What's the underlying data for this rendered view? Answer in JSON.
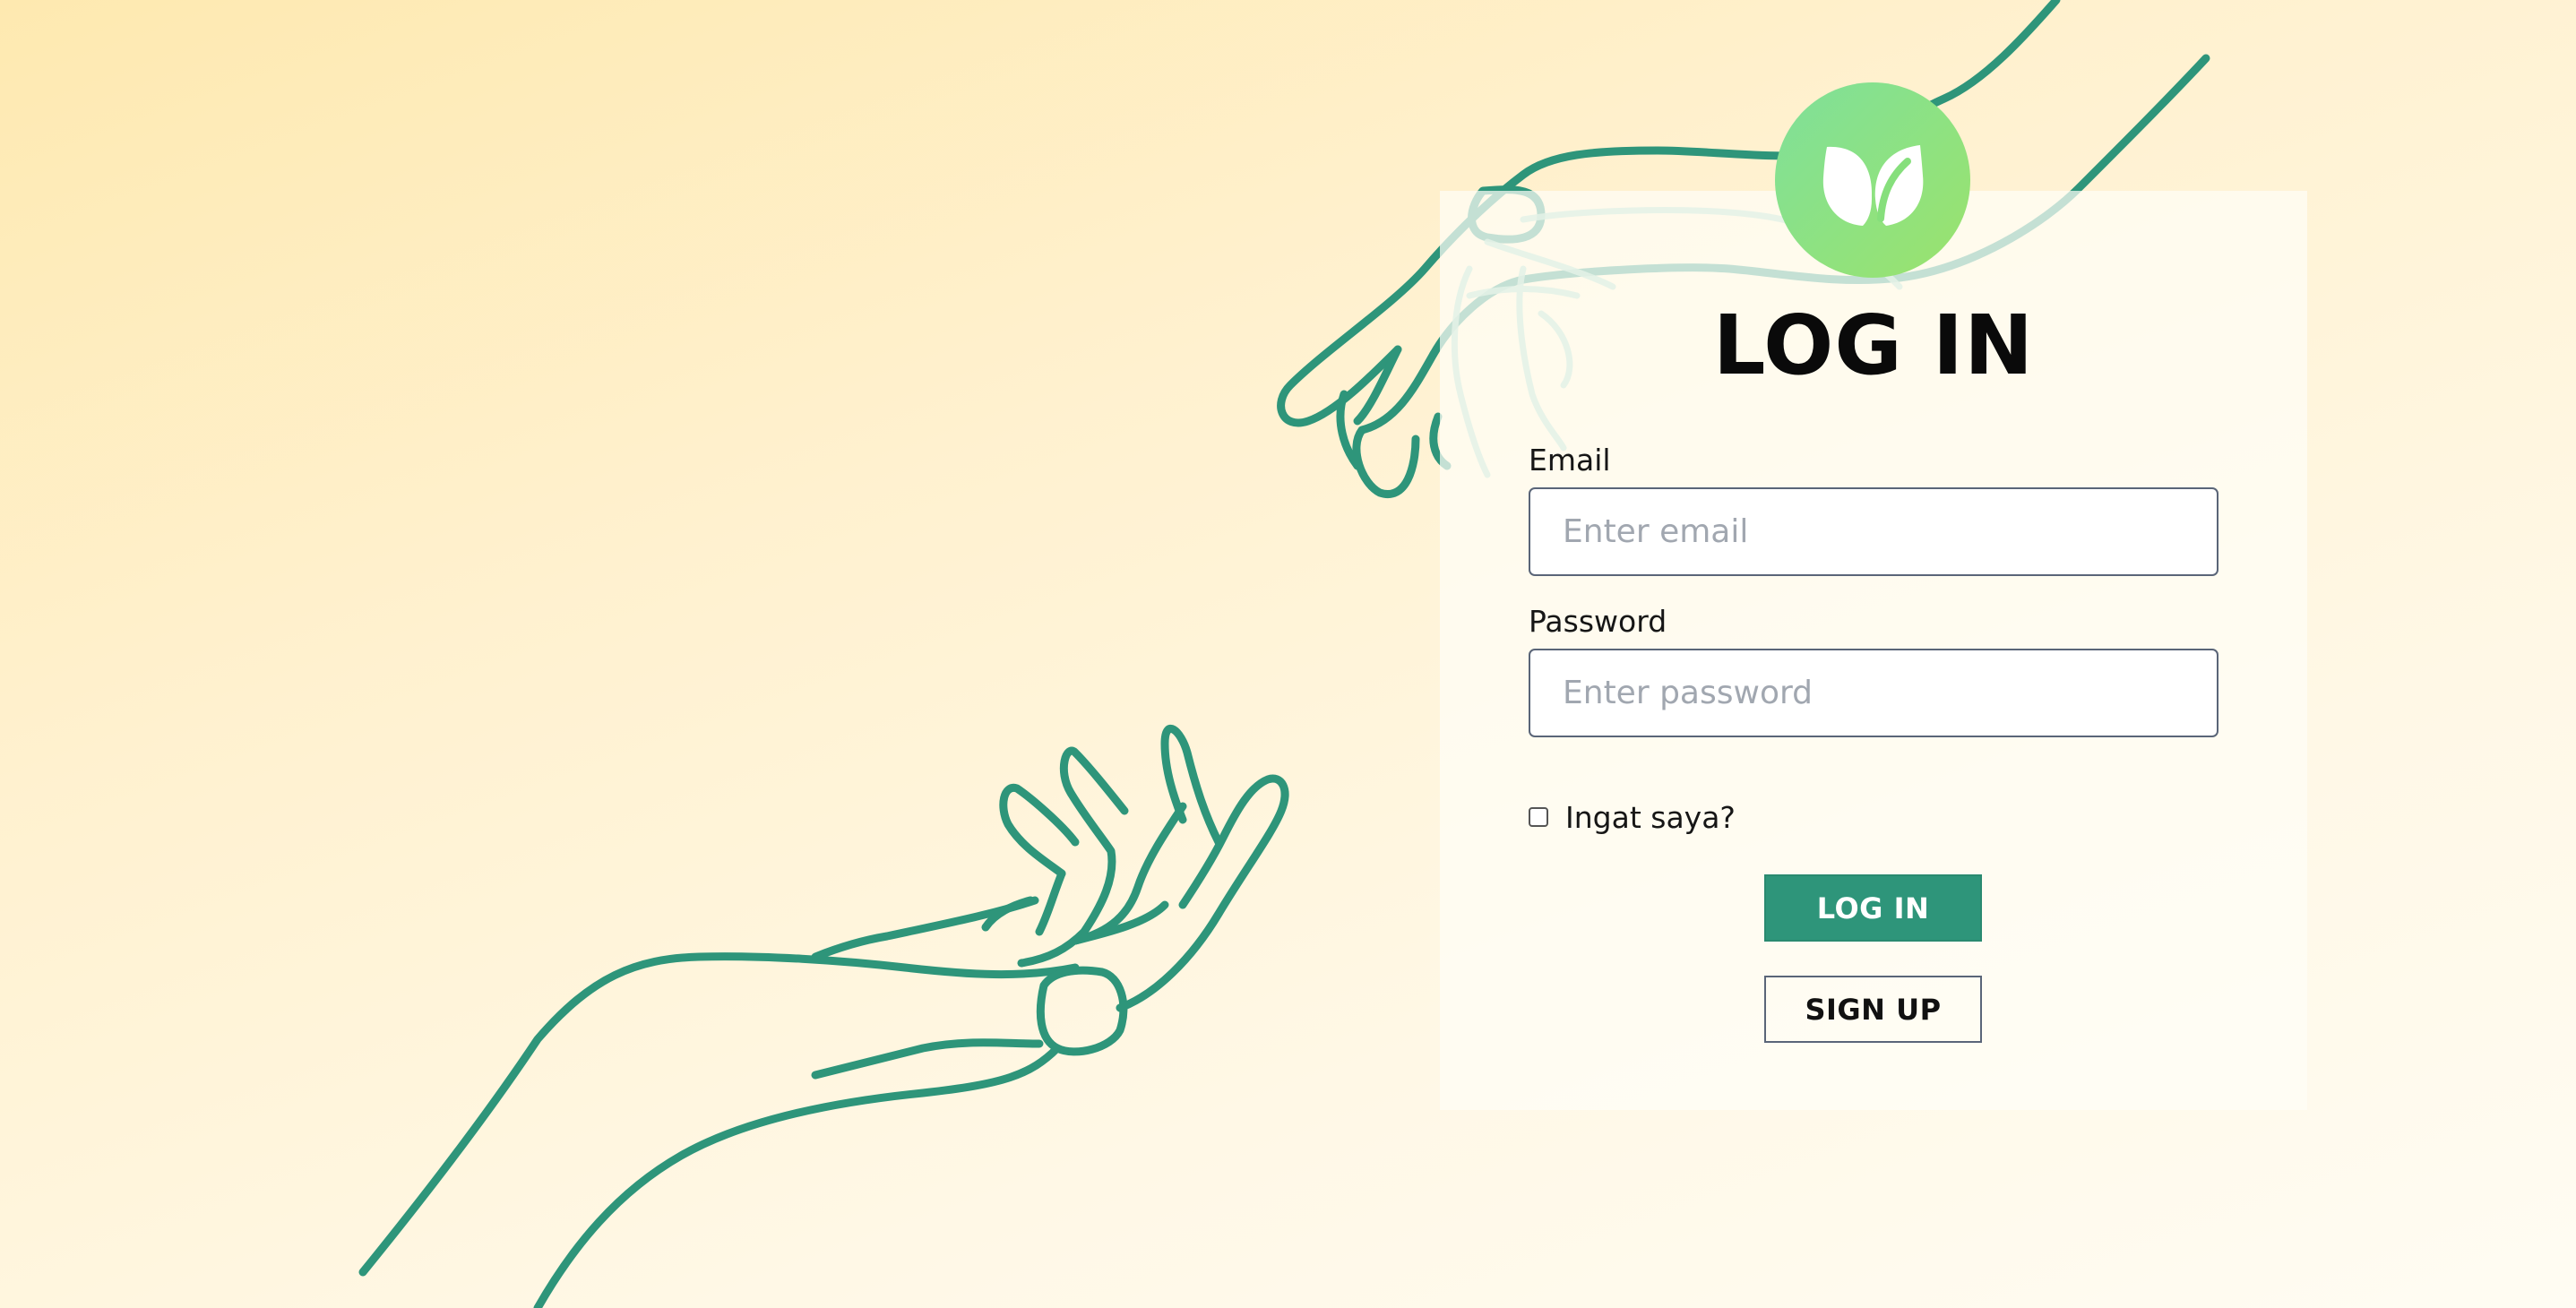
{
  "colors": {
    "accent": "#2e957a",
    "hand_stroke": "#2e957a",
    "logo_gradient_start": "#7fe09a",
    "logo_gradient_end": "#9be36c",
    "background_top": "#fee9b0",
    "background_bottom": "#fffcf3"
  },
  "logo": {
    "icon": "leaf-icon"
  },
  "login": {
    "title": "LOG IN",
    "email_label": "Email",
    "email_placeholder": "Enter email",
    "email_value": "",
    "password_label": "Password",
    "password_placeholder": "Enter password",
    "password_value": "",
    "remember_label": "Ingat saya?",
    "remember_checked": false,
    "login_button": "LOG IN",
    "signup_button": "SIGN UP"
  }
}
